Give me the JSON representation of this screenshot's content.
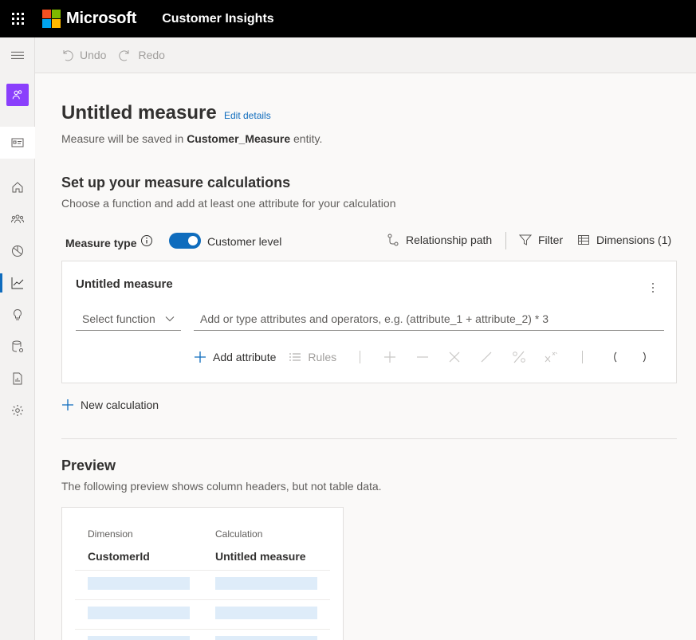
{
  "topbar": {
    "brand": "Microsoft",
    "app_name": "Customer Insights",
    "logo_colors": [
      "#f25022",
      "#7fba00",
      "#00a4ef",
      "#ffb900"
    ]
  },
  "sidebar": {
    "items": [
      {
        "icon": "hamburger-icon"
      },
      {
        "icon": "people-icon"
      },
      {
        "icon": "contact-card-icon"
      },
      {
        "icon": "home-icon"
      },
      {
        "icon": "people-group-icon"
      },
      {
        "icon": "pie-chart-icon"
      },
      {
        "icon": "line-chart-icon",
        "active": true
      },
      {
        "icon": "lightbulb-icon"
      },
      {
        "icon": "database-settings-icon"
      },
      {
        "icon": "report-icon"
      },
      {
        "icon": "settings-icon"
      }
    ],
    "accent": "#8a3ffc"
  },
  "command_bar": {
    "undo_label": "Undo",
    "redo_label": "Redo"
  },
  "header": {
    "title": "Untitled measure",
    "edit_link": "Edit details",
    "save_note_prefix": "Measure will be saved in ",
    "save_note_entity": "Customer_Measure",
    "save_note_suffix": " entity."
  },
  "setup": {
    "heading": "Set up your measure calculations",
    "subheading": "Choose a function and add at least one attribute for your calculation",
    "measure_type_label": "Measure type",
    "toggle_label": "Customer level",
    "toggle_on": true,
    "relationship_path_label": "Relationship path",
    "filter_label": "Filter",
    "dimensions_label": "Dimensions (1)"
  },
  "calculation": {
    "card_title": "Untitled measure",
    "function_select": "Select function",
    "expression_placeholder": "Add or type attributes and operators, e.g. (attribute_1 + attribute_2) * 3",
    "add_attribute_label": "Add attribute",
    "rules_label": "Rules",
    "operators": [
      "+",
      "−",
      "×",
      "/",
      "%",
      "x^y",
      "(",
      ")"
    ],
    "new_calculation_label": "New calculation"
  },
  "preview": {
    "heading": "Preview",
    "subheading": "The following preview shows column headers, but not table data.",
    "columns": [
      {
        "header": "Dimension",
        "value": "CustomerId"
      },
      {
        "header": "Calculation",
        "value": "Untitled measure"
      }
    ]
  },
  "colors": {
    "accent_blue": "#0f6cbd",
    "placeholder_row": "#deecf9"
  }
}
